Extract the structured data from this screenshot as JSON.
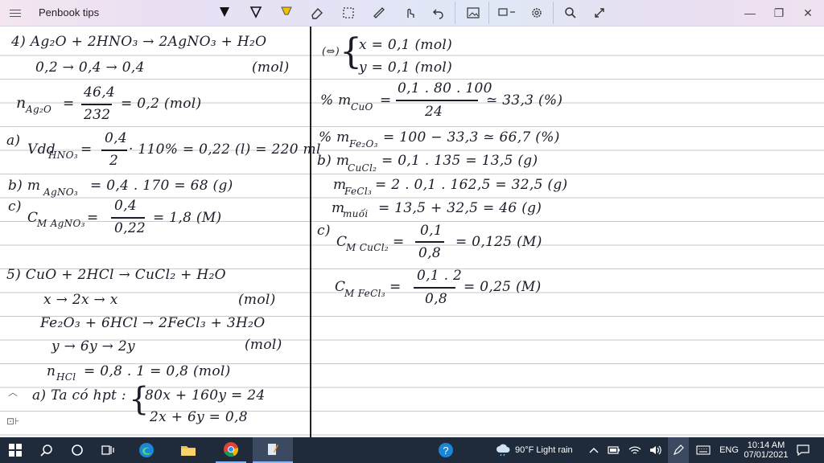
{
  "app": {
    "title": "Penbook tips"
  },
  "window": {
    "minimize": "—",
    "maximize": "❐",
    "close": "✕"
  },
  "left_page": [
    "4)  Ag₂O + 2HNO₃ → 2AgNO₃ + H₂O",
    "0,2  →  0,4  →  0,4",
    "(mol)",
    "n",
    "Ag₂O",
    "=",
    "46,4",
    "232",
    "= 0,2 (mol)",
    "a)",
    "Vdd",
    "HNO₃",
    "=",
    "0,4",
    "2",
    "· 110% = 0,22 (l) = 220 ml",
    "b)  m",
    "AgNO₃",
    "= 0,4 . 170 = 68 (g)",
    "c)",
    "C",
    "M AgNO₃",
    "=",
    "0,4",
    "0,22",
    "= 1,8 (M)",
    "5)   CuO + 2HCl → CuCl₂ + H₂O",
    "x  →  2x  →  x",
    "(mol)",
    "Fe₂O₃ + 6HCl → 2FeCl₃ + 3H₂O",
    "y  →  6y  →  2y",
    "(mol)",
    "n",
    "HCl",
    "= 0,8 . 1 = 0,8 (mol)",
    "a)  Ta có hpt :",
    "80x + 160y = 24",
    "2x + 6y = 0,8"
  ],
  "right_page": [
    "(⇔)",
    "x = 0,1 (mol)",
    "y = 0,1 (mol)",
    "% m",
    "CuO",
    "=",
    "0,1 . 80 . 100",
    "24",
    "≃ 33,3 (%)",
    "% m",
    "Fe₂O₃",
    "= 100 − 33,3 ≃ 66,7 (%)",
    "b)  m",
    "CuCl₂",
    "= 0,1 . 135 = 13,5 (g)",
    "m",
    "FeCl₃",
    "= 2 . 0,1 . 162,5 = 32,5 (g)",
    "m",
    "muối",
    "= 13,5 + 32,5 = 46 (g)",
    "c)",
    "C",
    "M CuCl₂",
    "=",
    "0,1",
    "0,8",
    "= 0,125 (M)",
    "C",
    "M FeCl₃",
    "=",
    "0,1 . 2",
    "0,8",
    "= 0,25 (M)"
  ],
  "taskbar": {
    "weather": "90°F  Light rain",
    "lang": "ENG",
    "time": "10:14 AM",
    "date": "07/01/2021"
  },
  "colors": {
    "ink": "#1b1b2a",
    "taskbar": "#1f2a3a",
    "accent": "#f0c000"
  }
}
